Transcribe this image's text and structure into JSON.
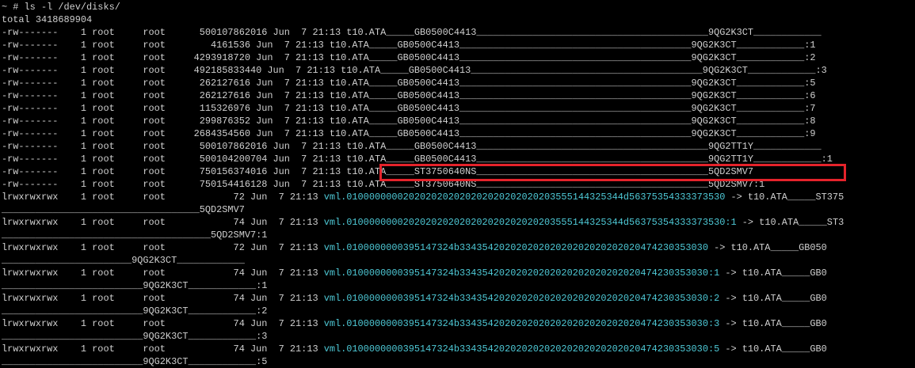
{
  "terminal": {
    "command": "~ # ls -l /dev/disks/",
    "total": "total 3418689904",
    "lines": [
      "-rw-------    1 root     root      500107862016 Jun  7 21:13 t10.ATA_____GB0500C4413_________________________________________9QG2K3CT____________",
      "-rw-------    1 root     root        4161536 Jun  7 21:13 t10.ATA_____GB0500C4413_________________________________________9QG2K3CT____________:1",
      "-rw-------    1 root     root     4293918720 Jun  7 21:13 t10.ATA_____GB0500C4413_________________________________________9QG2K3CT____________:2",
      "-rw-------    1 root     root     492185833440 Jun  7 21:13 t10.ATA_____GB0500C4413_________________________________________9QG2K3CT____________:3",
      "-rw-------    1 root     root      262127616 Jun  7 21:13 t10.ATA_____GB0500C4413_________________________________________9QG2K3CT____________:5",
      "-rw-------    1 root     root      262127616 Jun  7 21:13 t10.ATA_____GB0500C4413_________________________________________9QG2K3CT____________:6",
      "-rw-------    1 root     root      115326976 Jun  7 21:13 t10.ATA_____GB0500C4413_________________________________________9QG2K3CT____________:7",
      "-rw-------    1 root     root      299876352 Jun  7 21:13 t10.ATA_____GB0500C4413_________________________________________9QG2K3CT____________:8",
      "-rw-------    1 root     root     2684354560 Jun  7 21:13 t10.ATA_____GB0500C4413_________________________________________9QG2K3CT____________:9",
      "-rw-------    1 root     root      500107862016 Jun  7 21:13 t10.ATA_____GB0500C4413_________________________________________9QG2TT1Y____________",
      "-rw-------    1 root     root      500104200704 Jun  7 21:13 t10.ATA_____GB0500C4413_________________________________________9QG2TT1Y____________:1",
      "-rw-------    1 root     root      750156374016 Jun  7 21:13 t10.ATA_____ST3750640NS_________________________________________5QD2SMV7",
      "-rw-------    1 root     root      750154416128 Jun  7 21:13 t10.ATA_____ST3750640NS_________________________________________5QD2SMV7:1"
    ],
    "symlinks": [
      {
        "prefix": "lrwxrwxrwx    1 root     root            72 Jun  7 21:13 ",
        "vml": "vml.0100000000202020202020202020202020203555144325344d56375354333373530",
        "suffix": " -> t10.ATA_____ST375",
        "wrap": "___________________________________5QD2SMV7"
      },
      {
        "prefix": "lrwxrwxrwx    1 root     root            74 Jun  7 21:13 ",
        "vml": "vml.0100000000202020202020202020202020203555144325344d56375354333373530:1",
        "suffix": " -> t10.ATA_____ST3",
        "wrap": "_____________________________________5QD2SMV7:1"
      },
      {
        "prefix": "lrwxrwxrwx    1 root     root            72 Jun  7 21:13 ",
        "vml": "vml.0100000000395147324b33435420202020202020202020202020474230353030",
        "suffix": " -> t10.ATA_____GB050",
        "wrap": "_______________________9QG2K3CT____________"
      },
      {
        "prefix": "lrwxrwxrwx    1 root     root            74 Jun  7 21:13 ",
        "vml": "vml.0100000000395147324b33435420202020202020202020202020474230353030:1",
        "suffix": " -> t10.ATA_____GB0",
        "wrap": "_________________________9QG2K3CT____________:1"
      },
      {
        "prefix": "lrwxrwxrwx    1 root     root            74 Jun  7 21:13 ",
        "vml": "vml.0100000000395147324b33435420202020202020202020202020474230353030:2",
        "suffix": " -> t10.ATA_____GB0",
        "wrap": "_________________________9QG2K3CT____________:2"
      },
      {
        "prefix": "lrwxrwxrwx    1 root     root            74 Jun  7 21:13 ",
        "vml": "vml.0100000000395147324b33435420202020202020202020202020474230353030:3",
        "suffix": " -> t10.ATA_____GB0",
        "wrap": "_________________________9QG2K3CT____________:3"
      },
      {
        "prefix": "lrwxrwxrwx    1 root     root            74 Jun  7 21:13 ",
        "vml": "vml.0100000000395147324b33435420202020202020202020202020474230353030:5",
        "suffix": " -> t10.ATA_____GB0",
        "wrap": "_________________________9QG2K3CT____________:5"
      }
    ]
  },
  "colors": {
    "background": "#000000",
    "text": "#d0d0d0",
    "vml_link": "#4ec9d6",
    "highlight": "#e5232b"
  }
}
